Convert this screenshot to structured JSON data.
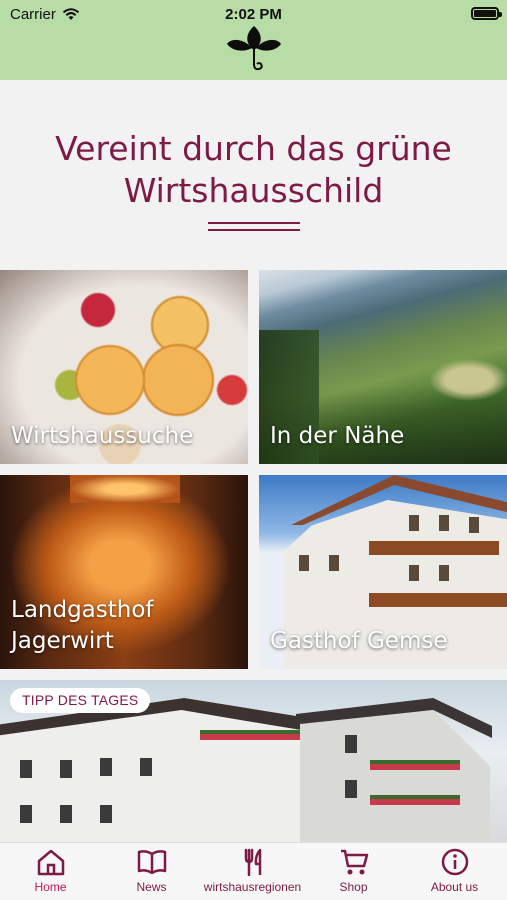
{
  "status": {
    "carrier": "Carrier",
    "time": "2:02 PM"
  },
  "headline": "Vereint durch das grüne Wirtshausschild",
  "tiles": [
    {
      "label": "Wirtshaussuche"
    },
    {
      "label": "In der Nähe"
    },
    {
      "label": "Landgasthof Jagerwirt"
    },
    {
      "label": "Gasthof Gemse"
    }
  ],
  "tipp": {
    "badge": "TIPP DES TAGES"
  },
  "tabs": [
    {
      "label": "Home",
      "icon": "home-icon",
      "active": true
    },
    {
      "label": "News",
      "icon": "book-icon"
    },
    {
      "label": "wirtshausregionen",
      "icon": "fork-knife-icon"
    },
    {
      "label": "Shop",
      "icon": "cart-icon"
    },
    {
      "label": "About us",
      "icon": "info-icon"
    }
  ],
  "colors": {
    "header": "#b8dca6",
    "brand": "#7d1a45",
    "active_tab": "#c2185b",
    "background": "#f2f2f2"
  }
}
